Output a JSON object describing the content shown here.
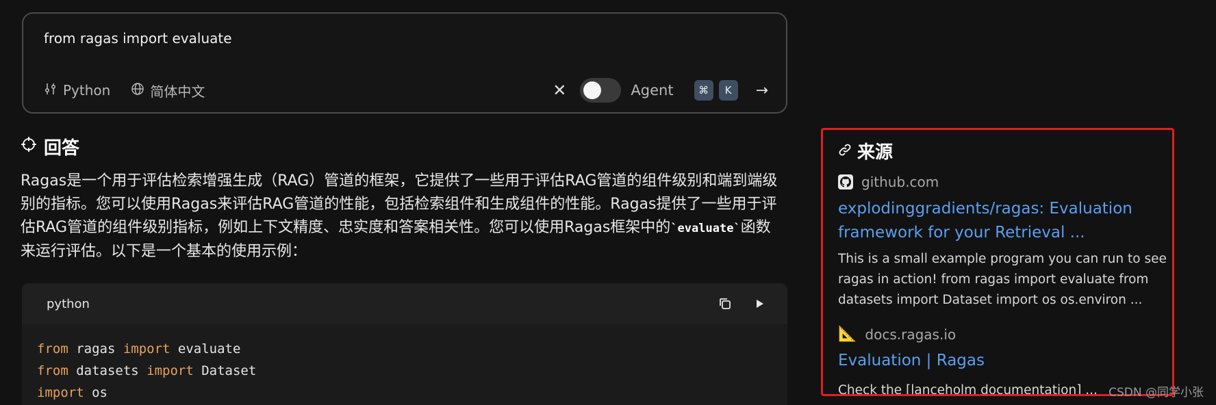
{
  "query": {
    "text": "from ragas import evaluate",
    "language_chip": "Python",
    "locale_chip": "简体中文",
    "agent_label": "Agent",
    "shortcut_keys": [
      "⌘",
      "K"
    ]
  },
  "answer": {
    "heading": "回答",
    "paragraph_before": "Ragas是一个用于评估检索增强生成（RAG）管道的框架，它提供了一些用于评估RAG管道的组件级别和端到端级别的指标。您可以使用Ragas来评估RAG管道的性能，包括检索组件和生成组件的性能。Ragas提供了一些用于评估RAG管道的组件级别指标，例如上下文精度、忠实度和答案相关性。您可以使用Ragas框架中的",
    "inline_code": "`evaluate`",
    "paragraph_after": "函数来运行评估。以下是一个基本的使用示例："
  },
  "code": {
    "language": "python",
    "lines": [
      [
        {
          "t": "from",
          "k": true
        },
        {
          "t": " ragas ",
          "k": false
        },
        {
          "t": "import",
          "k": true
        },
        {
          "t": " evaluate",
          "k": false
        }
      ],
      [
        {
          "t": "from",
          "k": true
        },
        {
          "t": " datasets ",
          "k": false
        },
        {
          "t": "import",
          "k": true
        },
        {
          "t": " Dataset",
          "k": false
        }
      ],
      [
        {
          "t": "import",
          "k": true
        },
        {
          "t": " os",
          "k": false
        }
      ]
    ]
  },
  "sources": {
    "heading": "来源",
    "items": [
      {
        "icon": "github-icon",
        "domain": "github.com",
        "title": "explodinggradients/ragas: Evaluation framework for your Retrieval ...",
        "snippet": "This is a small example program you can run to see ragas in action! from ragas import evaluate from datasets import Dataset import os os.environ ..."
      },
      {
        "icon": "triangle-ruler-icon",
        "domain": "docs.ragas.io",
        "title": "Evaluation | Ragas",
        "snippet": "Check the [lanceholm documentation] ..."
      }
    ]
  },
  "watermark": "CSDN @同学小张",
  "colors": {
    "background": "#121212",
    "link": "#5a9ff0",
    "keyword": "#e8a25c",
    "highlight_border": "#e02020"
  }
}
